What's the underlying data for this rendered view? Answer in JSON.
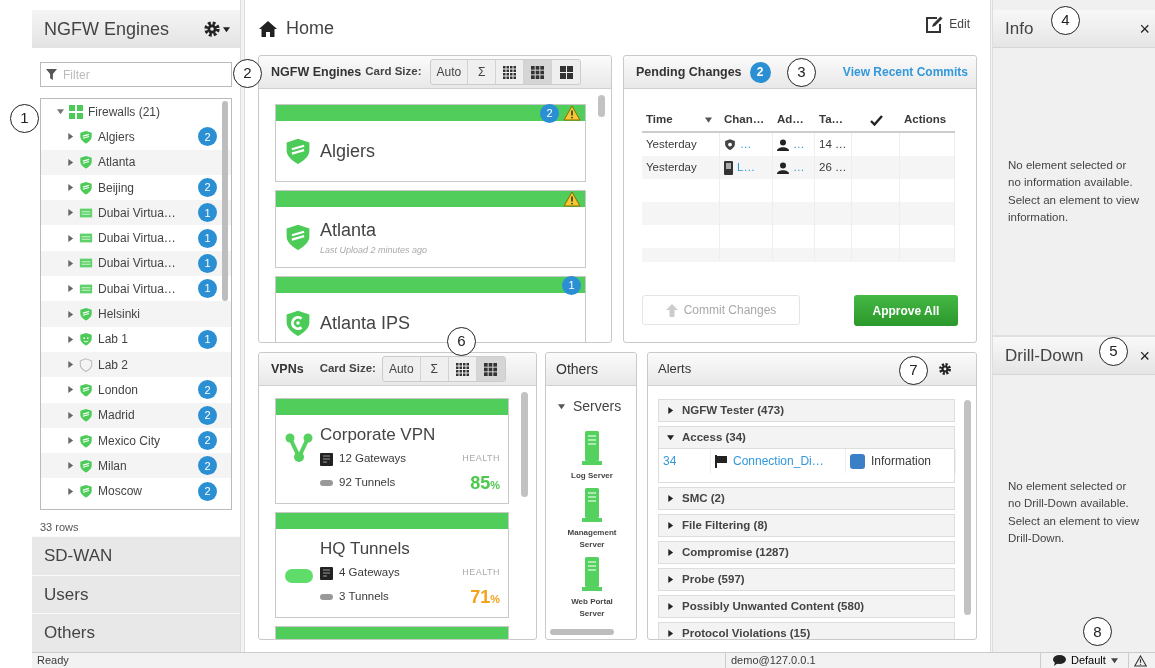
{
  "sidebar": {
    "title": "NGFW Engines",
    "filter": {
      "placeholder": "Filter"
    },
    "tree": {
      "callout": "1",
      "label": "Firewalls (21)",
      "expanded": true,
      "children": [
        {
          "label": "Algiers",
          "kind": "firewall",
          "badge": "2",
          "expanded": false
        },
        {
          "label": "Atlanta",
          "kind": "firewall",
          "expanded": false
        },
        {
          "label": "Beijing",
          "kind": "firewall",
          "badge": "2",
          "expanded": false
        },
        {
          "label": "Dubai Virtua…",
          "kind": "virtual",
          "badge": "1",
          "expanded": false
        },
        {
          "label": "Dubai Virtua…",
          "kind": "virtual",
          "badge": "1",
          "expanded": false
        },
        {
          "label": "Dubai Virtua…",
          "kind": "virtual",
          "badge": "1",
          "expanded": false
        },
        {
          "label": "Dubai Virtua…",
          "kind": "virtual",
          "badge": "1",
          "expanded": false
        },
        {
          "label": "Helsinki",
          "kind": "firewall",
          "expanded": false
        },
        {
          "label": "Lab 1",
          "kind": "lab",
          "badge": "1",
          "expanded": false
        },
        {
          "label": "Lab 2",
          "kind": "offline",
          "expanded": false
        },
        {
          "label": "London",
          "kind": "firewall",
          "badge": "2",
          "expanded": false
        },
        {
          "label": "Madrid",
          "kind": "firewall",
          "badge": "2",
          "expanded": false
        },
        {
          "label": "Mexico City",
          "kind": "firewall",
          "badge": "2",
          "expanded": false
        },
        {
          "label": "Milan",
          "kind": "firewall",
          "badge": "2",
          "expanded": false
        },
        {
          "label": "Moscow",
          "kind": "firewall",
          "badge": "2",
          "expanded": false
        }
      ]
    },
    "row_count": "33 rows",
    "sections": [
      {
        "label": "SD-WAN"
      },
      {
        "label": "Users"
      },
      {
        "label": "Others"
      }
    ]
  },
  "header": {
    "title": "Home",
    "edit": "Edit"
  },
  "engines_panel": {
    "callout": "2",
    "title": "NGFW Engines",
    "card_size_label": "Card Size:",
    "size_buttons": [
      {
        "kind": "text",
        "label": "Auto",
        "selected": false
      },
      {
        "kind": "text",
        "label": "Σ",
        "selected": false
      },
      {
        "kind": "fine",
        "selected": false
      },
      {
        "kind": "medium",
        "selected": true
      },
      {
        "kind": "coarse",
        "selected": false
      }
    ],
    "cards": [
      {
        "name": "Algiers",
        "kind": "firewall",
        "badge": "2",
        "warning": true
      },
      {
        "name": "Atlanta",
        "kind": "firewall",
        "warning": true,
        "note": "Last Upload 2 minutes ago"
      },
      {
        "name": "Atlanta IPS",
        "kind": "ips",
        "badge": "1",
        "warning": false
      }
    ]
  },
  "pending_changes": {
    "callout": "3",
    "title": "Pending Changes",
    "count": "2",
    "link": "View Recent Commits",
    "columns": [
      {
        "kind": "text",
        "label": "Time",
        "sorted": true
      },
      {
        "kind": "text",
        "label": "Chan…",
        "sorted": false
      },
      {
        "kind": "text",
        "label": "Ad…",
        "sorted": false
      },
      {
        "kind": "text",
        "label": "Ta…",
        "sorted": false
      },
      {
        "kind": "check",
        "sorted": false
      },
      {
        "kind": "text",
        "label": "Actions",
        "sorted": false
      }
    ],
    "rows": [
      {
        "kind": "engine",
        "time": "Yesterday",
        "change": "…",
        "admin": "…",
        "target": "14 …"
      },
      {
        "kind": "server",
        "time": "Yesterday",
        "change": "L…",
        "admin": "…",
        "target": "26 …"
      }
    ],
    "buttons": [
      {
        "kind": "commit",
        "label": "Commit Changes",
        "disabled": true
      },
      {
        "kind": "approve",
        "label": "Approve All",
        "disabled": false
      }
    ]
  },
  "vpns_panel": {
    "callout": "6",
    "title": "VPNs",
    "card_size_label": "Card Size:",
    "size_buttons": [
      {
        "kind": "text",
        "label": "Auto",
        "selected": false
      },
      {
        "kind": "text",
        "label": "Σ",
        "selected": false
      },
      {
        "kind": "fine",
        "selected": false
      },
      {
        "kind": "medium",
        "selected": true
      }
    ],
    "cards": [
      {
        "kind": "vpn",
        "name": "Corporate VPN",
        "gateways": "12 Gateways",
        "tunnels": "92 Tunnels",
        "health_label": "HEALTH",
        "health": "85",
        "unit": "%",
        "color": "#4cc94c"
      },
      {
        "kind": "tunnel",
        "name": "HQ Tunnels",
        "gateways": "4 Gateways",
        "tunnels": "3 Tunnels",
        "health_label": "HEALTH",
        "health": "71",
        "unit": "%",
        "color": "#f5a21c"
      },
      {
        "kind": "partial"
      }
    ]
  },
  "others_panel": {
    "title": "Others",
    "group": {
      "label": "Servers",
      "expanded": true
    },
    "servers": [
      {
        "label": "Log Server"
      },
      {
        "label": "Management Server"
      },
      {
        "label": "Web Portal Server"
      }
    ]
  },
  "alerts": {
    "callout": "7",
    "title": "Alerts",
    "groups": [
      {
        "label": "NGFW Tester (473)",
        "expanded": false
      },
      {
        "label": "Access (34)",
        "expanded": true,
        "rows": [
          {
            "count": "34",
            "name": "Connection_Di…",
            "severity": "Information",
            "color": "#3b7fc6"
          }
        ]
      },
      {
        "label": "SMC (2)",
        "expanded": false
      },
      {
        "label": "File Filtering (8)",
        "expanded": false
      },
      {
        "label": "Compromise (1287)",
        "expanded": false
      },
      {
        "label": "Probe (597)",
        "expanded": false
      },
      {
        "label": "Possibly Unwanted Content (580)",
        "expanded": false
      },
      {
        "label": "Protocol Violations (15)",
        "expanded": false
      }
    ]
  },
  "info_panel": {
    "callout": "4",
    "title": "Info",
    "close": "×",
    "message": "No element selected or no information available. Select an element to view information."
  },
  "drilldown_panel": {
    "callout": "5",
    "title": "Drill-Down",
    "close": "×",
    "message": "No element selected or no Drill-Down available. Select an element to view Drill-Down."
  },
  "status_bar": {
    "callout": "8",
    "status": "Ready",
    "user": "demo@127.0.0.1",
    "profile": "Default"
  }
}
